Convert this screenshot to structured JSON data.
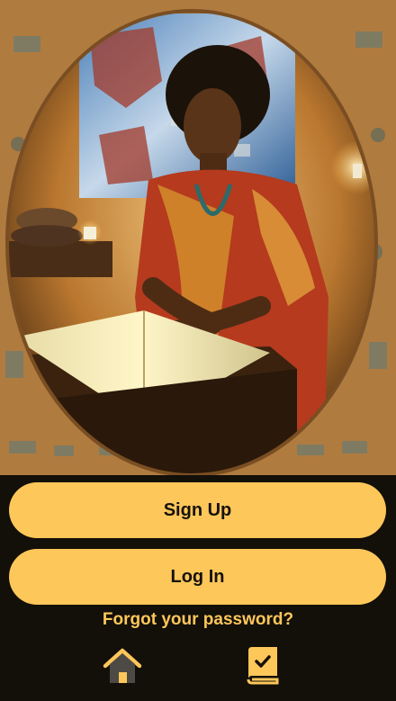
{
  "hero": {
    "image_name": "reading-woman-illustration"
  },
  "auth": {
    "signup_label": "Sign Up",
    "login_label": "Log In",
    "forgot_label": "Forgot your password?"
  },
  "nav": {
    "items": [
      {
        "icon": "home-icon"
      },
      {
        "icon": "book-check-icon"
      }
    ]
  },
  "colors": {
    "background": "#130f09",
    "accent": "#fdc75a",
    "button_text": "#16110a"
  }
}
